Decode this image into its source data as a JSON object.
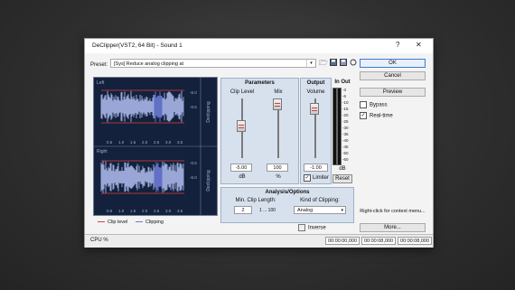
{
  "window": {
    "title": "DeClipper(VST2, 64 Bit) - Sound 1",
    "help_glyph": "?",
    "close_glyph": "✕"
  },
  "preset": {
    "label": "Preset:",
    "value": "[Sys] Reduce analog clipping at",
    "arrow": "▾"
  },
  "toolbar_icons": [
    "folder-icon",
    "save-icon",
    "save-as-icon",
    "reset-icon"
  ],
  "buttons": {
    "ok": "OK",
    "cancel": "Cancel",
    "preview": "Preview",
    "more": "More...",
    "reset": "Reset"
  },
  "checks": {
    "bypass": "Bypass",
    "realtime": "Real-time",
    "realtime_checked": true,
    "bypass_checked": false
  },
  "hint": "Right-click for context menu...",
  "waveform": {
    "channel_left": "Left",
    "channel_right": "Right",
    "side_label": "Declipping",
    "db_ticks": [
      "-6.0",
      "-0.5",
      "-0.5",
      "-6.0"
    ],
    "time_ticks": [
      "0.5",
      "1.0",
      "1.5",
      "2.0",
      "2.5",
      "3.0",
      "3.5"
    ],
    "colors": {
      "background": "#13213c",
      "wave": "#a9b6e8",
      "clip_line": "#e04040",
      "clipping": "#6c7bd6"
    }
  },
  "legend": {
    "clip_level": "Clip level",
    "clipping": "Clipping"
  },
  "parameters": {
    "title": "Parameters",
    "clip_level": {
      "label": "Clip Level",
      "value": "-5.00",
      "unit": "dB",
      "level": 0.55
    },
    "mix": {
      "label": "Mix",
      "value": "100",
      "unit": "%",
      "level": 1.0
    }
  },
  "output": {
    "title": "Output",
    "volume_label": "Volume",
    "value": "-1.00",
    "level": 0.9,
    "limiter_label": "Limiter",
    "limiter_checked": true
  },
  "meter": {
    "title_in": "In",
    "title_out": "Out",
    "scale": [
      "-3",
      "-6",
      "-10",
      "-15",
      "-20",
      "-25",
      "-30",
      "-35",
      "-40",
      "-45",
      "-50",
      "-60"
    ],
    "unit": "dB"
  },
  "analysis": {
    "title": "Analysis/Options",
    "min_clip_label": "Min. Clip Length:",
    "min_clip_value": "2",
    "min_clip_range": "1 ... 100",
    "kind_label": "Kind of Clipping:",
    "kind_value": "Analog",
    "inverse_label": "Inverse"
  },
  "status": {
    "cpu": "CPU %",
    "fields": [
      "00:00:00,000",
      "00:00:08,000",
      "00:00:08,000"
    ]
  }
}
